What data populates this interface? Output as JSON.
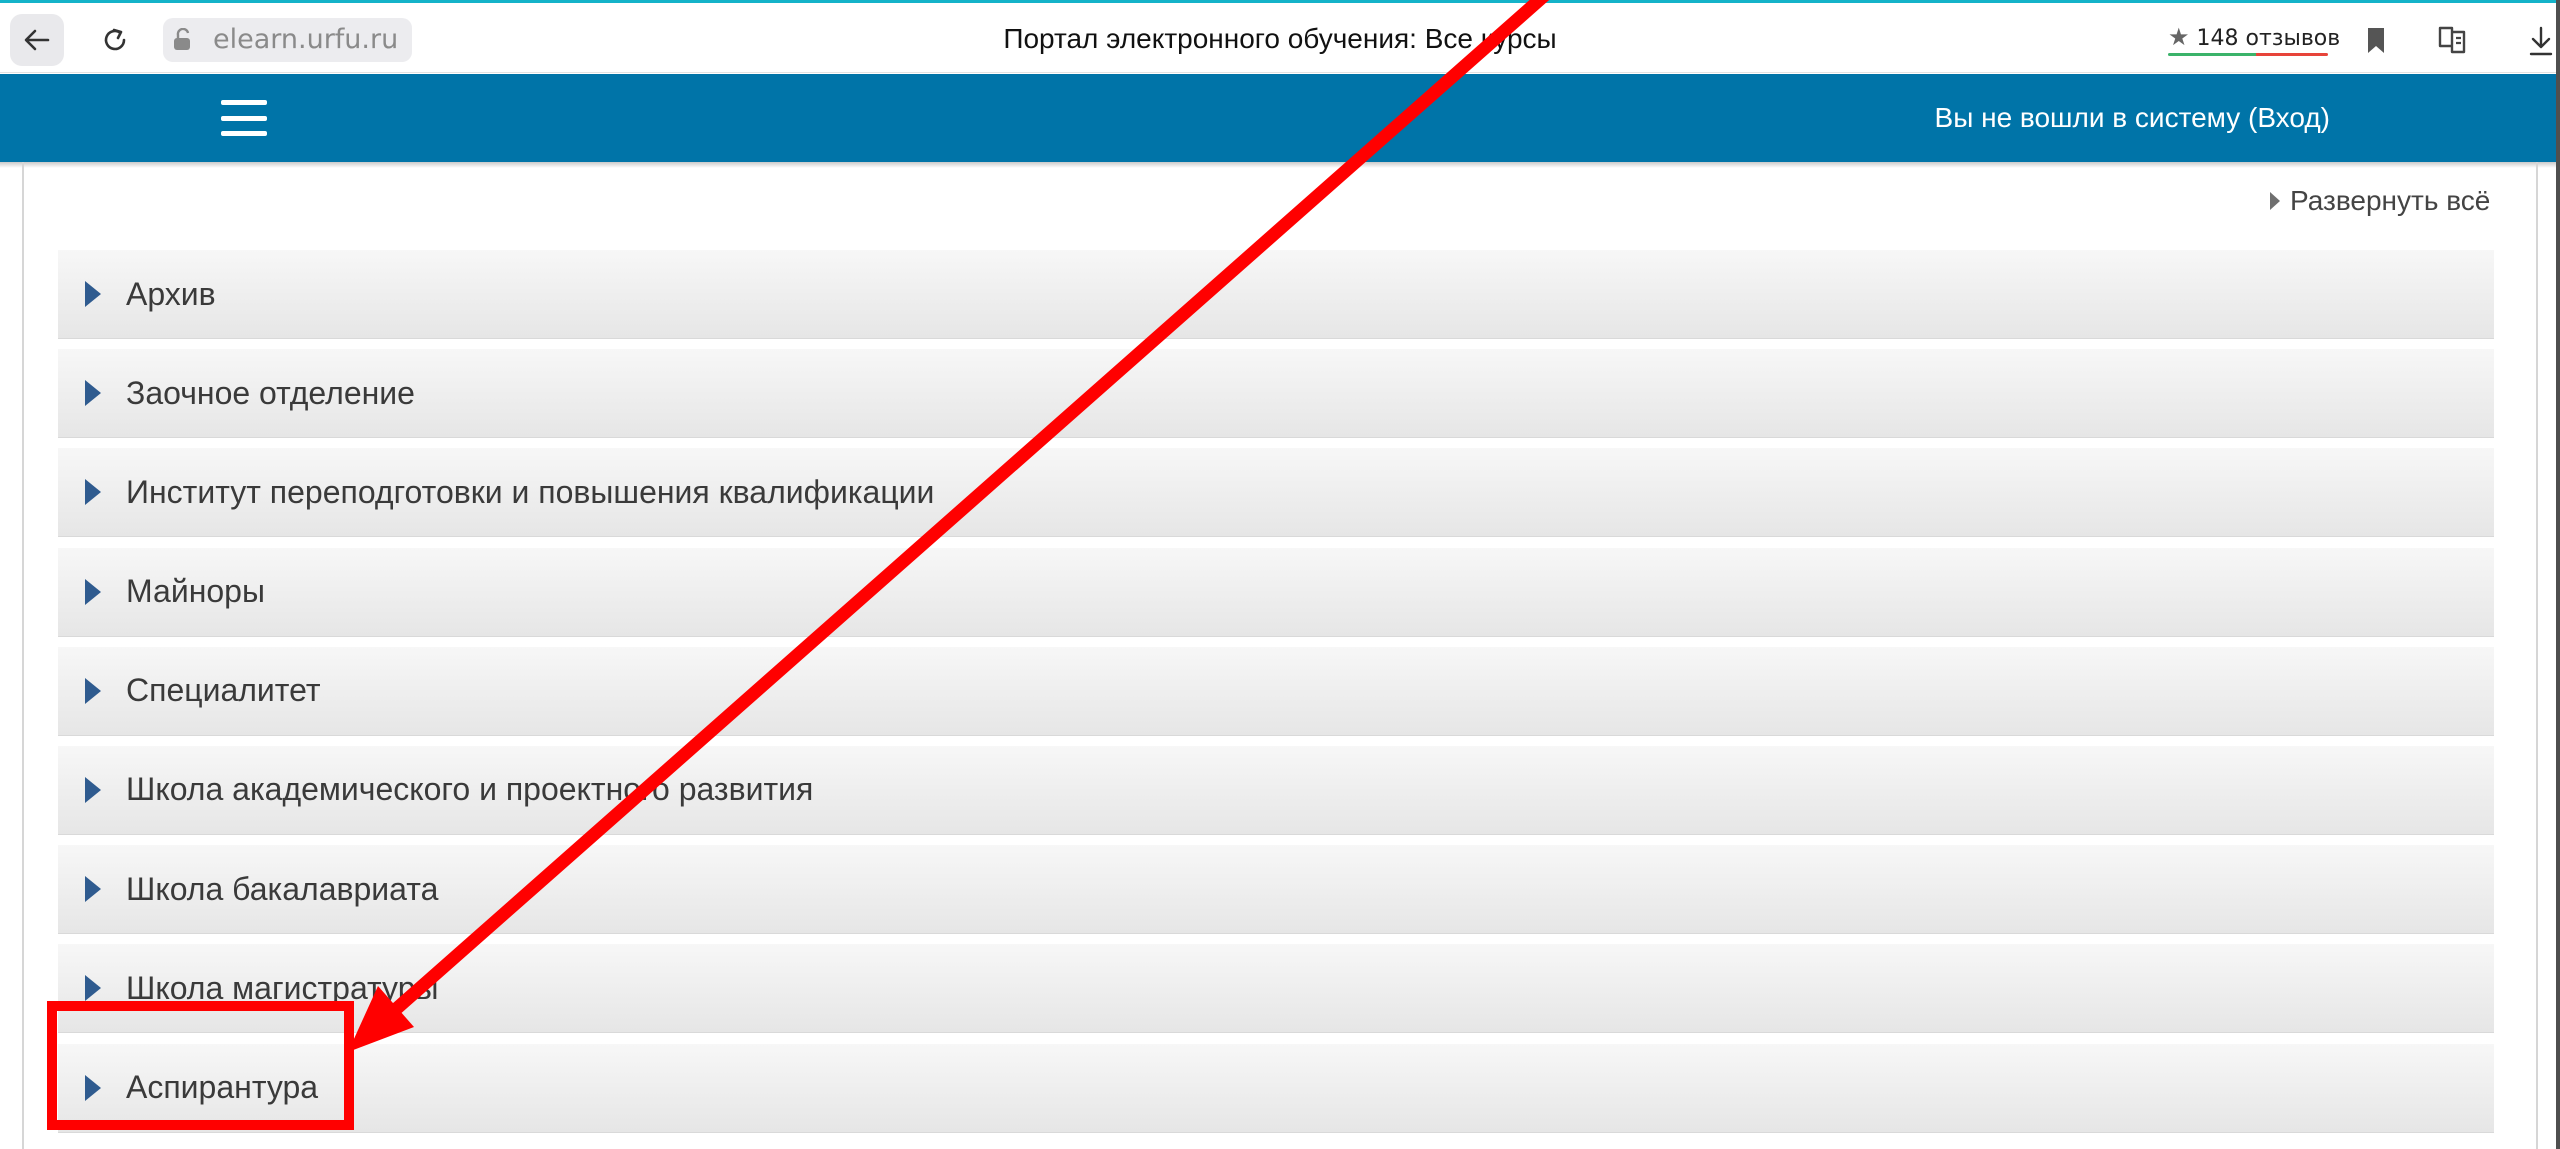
{
  "browser": {
    "url_domain": "elearn.urfu.ru",
    "tab_title": "Портал электронного обучения: Все курсы",
    "reviews_label": "148 отзывов",
    "icons": [
      "back-arrow-icon",
      "reload-icon",
      "lock-icon",
      "star-icon",
      "bookmark-icon",
      "reader-mode-icon",
      "download-icon"
    ]
  },
  "navbar": {
    "login_text": "Вы не вошли в систему (Вход)",
    "color": "#0074a8"
  },
  "main": {
    "expand_all_label": "Развернуть всё",
    "categories": [
      {
        "label": "Архив"
      },
      {
        "label": "Заочное отделение"
      },
      {
        "label": "Институт переподготовки и повышения квалификации"
      },
      {
        "label": "Майноры"
      },
      {
        "label": "Специалитет"
      },
      {
        "label": "Школа академического и проектного развития"
      },
      {
        "label": "Школа бакалавриата"
      },
      {
        "label": "Школа магистратуры"
      },
      {
        "label": "Аспирантура"
      }
    ]
  },
  "annotation": {
    "color": "#ff0000",
    "highlighted_category": "Аспирантура"
  }
}
